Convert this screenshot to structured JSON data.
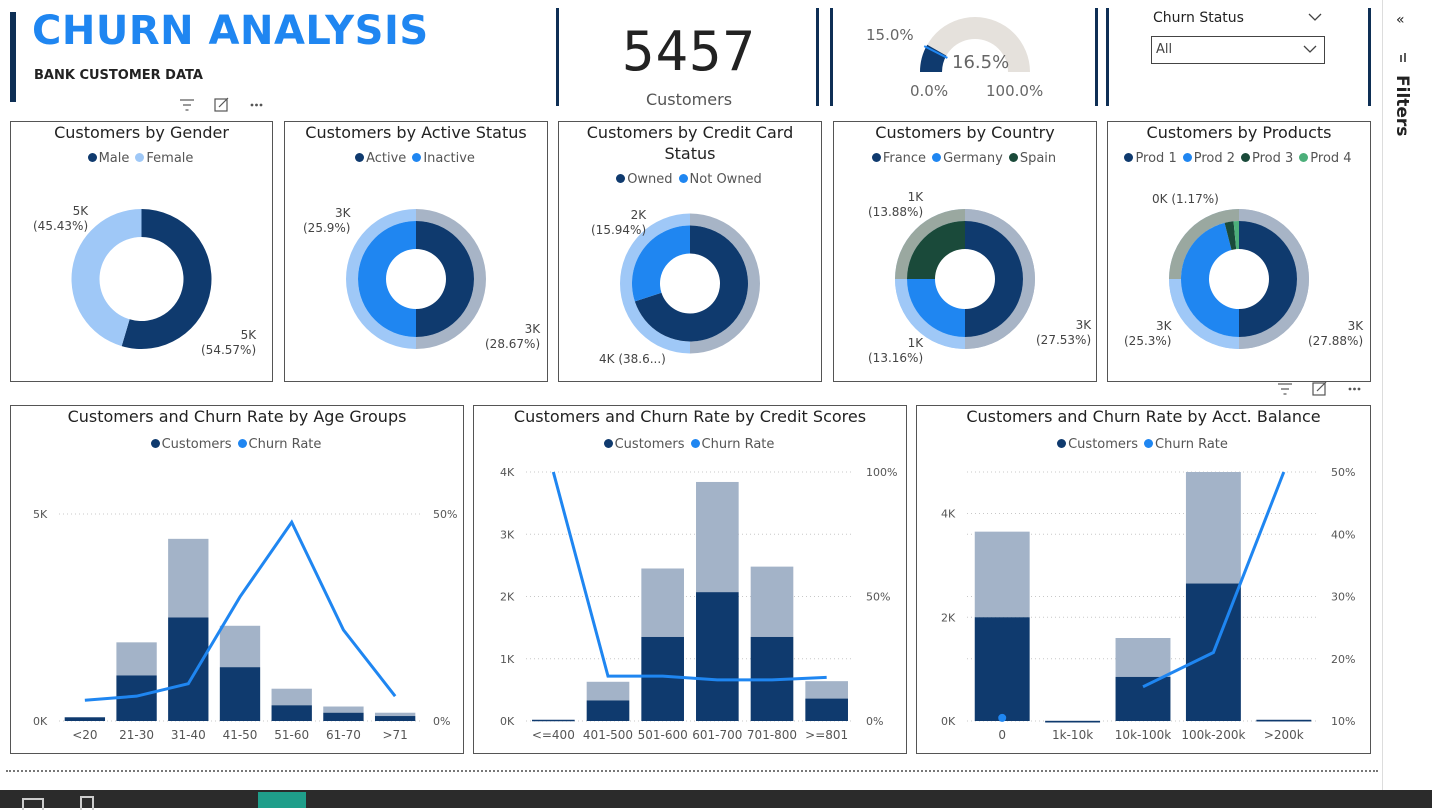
{
  "header": {
    "title": "CHURN ANALYSIS",
    "subtitle": "BANK CUSTOMER DATA"
  },
  "kpi": {
    "value": "5457",
    "label": "Customers"
  },
  "gauge": {
    "value_label": "16.5%",
    "target_label": "15.0%",
    "min_label": "0.0%",
    "max_label": "100.0%",
    "value": 0.165,
    "target": 0.15
  },
  "slicer": {
    "title": "Churn Status",
    "selected": "All"
  },
  "right_panel": {
    "label": "Filters"
  },
  "colors": {
    "dark": "#0f3a6e",
    "blue": "#1f86f1",
    "light": "#9fc8f7",
    "green_dark": "#1a4a3a",
    "green": "#4caf7a",
    "outer": "#a7b4c6",
    "accent_title": "#1f86f1"
  },
  "donuts": [
    {
      "title": "Customers by Gender",
      "legend": [
        {
          "label": "Male",
          "color": "#0f3a6e"
        },
        {
          "label": "Female",
          "color": "#9fc8f7"
        }
      ],
      "inner": [
        {
          "value": 54.57,
          "color": "#0f3a6e"
        },
        {
          "value": 45.43,
          "color": "#9fc8f7"
        }
      ],
      "outer": [],
      "labels": [
        {
          "text": "5K",
          "sub": "(45.43%)"
        },
        {
          "text": "5K",
          "sub": "(54.57%)"
        }
      ]
    },
    {
      "title": "Customers by Active Status",
      "legend": [
        {
          "label": "Active",
          "color": "#0f3a6e"
        },
        {
          "label": "Inactive",
          "color": "#1f86f1"
        }
      ],
      "inner": [
        {
          "value": 50,
          "color": "#0f3a6e"
        },
        {
          "value": 50,
          "color": "#1f86f1"
        }
      ],
      "outer": [
        {
          "value": 28.67,
          "color": "#a7b4c6"
        },
        {
          "value": 25.9,
          "color": "#9fc8f7"
        }
      ],
      "labels": [
        {
          "text": "3K",
          "sub": "(25.9%)"
        },
        {
          "text": "3K",
          "sub": "(28.67%)"
        }
      ]
    },
    {
      "title": "Customers by Credit Card Status",
      "legend": [
        {
          "label": "Owned",
          "color": "#0f3a6e"
        },
        {
          "label": "Not Owned",
          "color": "#1f86f1"
        }
      ],
      "inner": [
        {
          "value": 70,
          "color": "#0f3a6e"
        },
        {
          "value": 30,
          "color": "#1f86f1"
        }
      ],
      "outer": [
        {
          "value": 38.6,
          "color": "#a7b4c6"
        },
        {
          "value": 15.94,
          "color": "#9fc8f7"
        }
      ],
      "labels": [
        {
          "text": "2K",
          "sub": "(15.94%)"
        },
        {
          "text": "4K (38.6...)",
          "sub": ""
        }
      ]
    },
    {
      "title": "Customers by Country",
      "legend": [
        {
          "label": "France",
          "color": "#0f3a6e"
        },
        {
          "label": "Germany",
          "color": "#1f86f1"
        },
        {
          "label": "Spain",
          "color": "#1a4a3a"
        }
      ],
      "inner": [
        {
          "value": 50,
          "color": "#0f3a6e"
        },
        {
          "value": 25,
          "color": "#1f86f1"
        },
        {
          "value": 25,
          "color": "#1a4a3a"
        }
      ],
      "outer": [
        {
          "value": 27.53,
          "color": "#a7b4c6"
        },
        {
          "value": 13.16,
          "color": "#9fc8f7"
        },
        {
          "value": 13.88,
          "color": "#9aa8a0"
        }
      ],
      "labels": [
        {
          "text": "1K",
          "sub": "(13.88%)"
        },
        {
          "text": "3K",
          "sub": "(27.53%)"
        },
        {
          "text": "1K",
          "sub": "(13.16%)"
        }
      ]
    },
    {
      "title": "Customers by Products",
      "legend": [
        {
          "label": "Prod 1",
          "color": "#0f3a6e"
        },
        {
          "label": "Prod 2",
          "color": "#1f86f1"
        },
        {
          "label": "Prod 3",
          "color": "#1a4a3a"
        },
        {
          "label": "Prod 4",
          "color": "#4caf7a"
        }
      ],
      "inner": [
        {
          "value": 50,
          "color": "#0f3a6e"
        },
        {
          "value": 46,
          "color": "#1f86f1"
        },
        {
          "value": 2.5,
          "color": "#1a4a3a"
        },
        {
          "value": 1.5,
          "color": "#4caf7a"
        }
      ],
      "outer": [
        {
          "value": 27.88,
          "color": "#a7b4c6"
        },
        {
          "value": 25.3,
          "color": "#9fc8f7"
        },
        {
          "value": 1.17,
          "color": "#9aa8a0"
        }
      ],
      "labels": [
        {
          "text": "0K (1.17%)",
          "sub": ""
        },
        {
          "text": "3K",
          "sub": "(25.3%)"
        },
        {
          "text": "3K",
          "sub": "(27.88%)"
        }
      ]
    }
  ],
  "chart_data": [
    {
      "type": "bar",
      "title": "Customers and Churn Rate by Age Groups",
      "legend": [
        "Customers",
        "Churn Rate"
      ],
      "categories": [
        "<20",
        "21-30",
        "31-40",
        "41-50",
        "51-60",
        "61-70",
        ">71"
      ],
      "series": [
        {
          "name": "Customers",
          "values": [
            90,
            1100,
            2500,
            1300,
            380,
            200,
            120
          ]
        },
        {
          "name": "Customers",
          "values": [
            0,
            800,
            1900,
            1000,
            400,
            150,
            80
          ]
        },
        {
          "name": "Churn Rate",
          "values": [
            5,
            6,
            9,
            30,
            48,
            22,
            6
          ]
        }
      ],
      "y_left_ticks": [
        "0K",
        "5K"
      ],
      "y_right_ticks": [
        "0%",
        "50%"
      ],
      "ylim": [
        0,
        5000
      ],
      "y2lim": [
        0,
        50
      ]
    },
    {
      "type": "bar",
      "title": "Customers and Churn Rate by Credit Scores",
      "legend": [
        "Customers",
        "Churn Rate"
      ],
      "categories": [
        "<=400",
        "401-500",
        "501-600",
        "601-700",
        "701-800",
        ">=801"
      ],
      "series": [
        {
          "name": "Customers",
          "values": [
            20,
            330,
            1350,
            2070,
            1350,
            360
          ]
        },
        {
          "name": "Customers",
          "values": [
            0,
            300,
            1100,
            1770,
            1130,
            280
          ]
        },
        {
          "name": "Churn Rate",
          "values": [
            100,
            18,
            18,
            16.5,
            16.5,
            17.5
          ]
        }
      ],
      "y_left_ticks": [
        "0K",
        "1K",
        "2K",
        "3K",
        "4K"
      ],
      "y_right_ticks": [
        "0%",
        "50%",
        "100%"
      ],
      "ylim": [
        0,
        4000
      ],
      "y2lim": [
        0,
        100
      ]
    },
    {
      "type": "bar",
      "title": "Customers and Churn Rate by Acct. Balance",
      "legend": [
        "Customers",
        "Churn Rate"
      ],
      "categories": [
        "0",
        "1k-10k",
        "10k-100k",
        "100k-200k",
        ">200k"
      ],
      "series": [
        {
          "name": "Customers",
          "values": [
            2000,
            0,
            850,
            2650,
            20
          ]
        },
        {
          "name": "Customers",
          "values": [
            1650,
            10,
            750,
            2150,
            10
          ]
        },
        {
          "name": "Churn Rate",
          "values": [
            10.5,
            null,
            15.5,
            21,
            50
          ]
        }
      ],
      "y_left_ticks": [
        "0K",
        "2K",
        "4K"
      ],
      "y_right_ticks": [
        "10%",
        "20%",
        "30%",
        "40%",
        "50%"
      ],
      "ylim": [
        0,
        4800
      ],
      "y2lim": [
        10,
        50
      ]
    }
  ]
}
